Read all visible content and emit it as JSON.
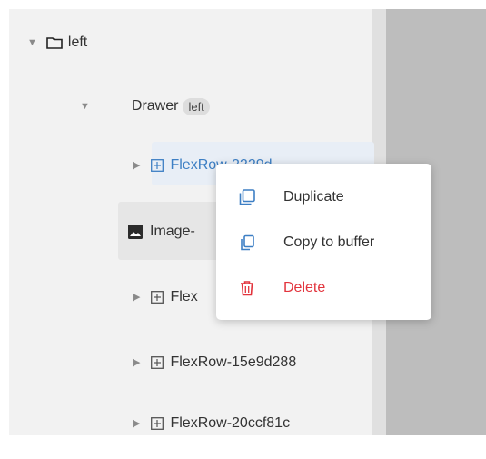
{
  "tree": {
    "root": {
      "label": "left",
      "caret": "▼",
      "icon": "folder-icon"
    },
    "drawer": {
      "label": "Drawer",
      "badge": "left",
      "caret": "▼"
    },
    "items": [
      {
        "label": "FlexRow-2229d...",
        "icon": "grid-icon",
        "caret": "▶",
        "highlighted": true
      },
      {
        "label": "Image-",
        "icon": "image-icon",
        "selected": true
      },
      {
        "label": "Flex",
        "icon": "grid-icon",
        "caret": "▶"
      },
      {
        "label": "FlexRow-15e9d288",
        "icon": "grid-icon",
        "caret": "▶"
      },
      {
        "label": "FlexRow-20ccf81c",
        "icon": "grid-icon",
        "caret": "▶"
      }
    ]
  },
  "context_menu": {
    "items": [
      {
        "label": "Duplicate",
        "icon": "duplicate-icon",
        "color": "#333333"
      },
      {
        "label": "Copy to buffer",
        "icon": "copy-icon",
        "color": "#333333"
      },
      {
        "label": "Delete",
        "icon": "trash-icon",
        "color": "#e2343d"
      }
    ]
  },
  "colors": {
    "accent": "#3d7fc4",
    "danger": "#e2343d",
    "panel": "#f2f2f2",
    "canvas": "#bdbdbd"
  }
}
